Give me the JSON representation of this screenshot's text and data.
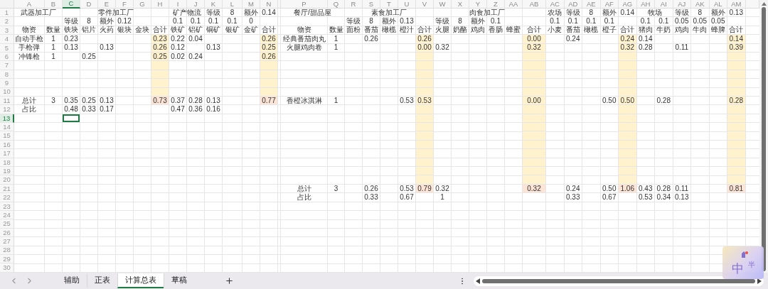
{
  "columns": [
    {
      "letter": "A",
      "selected": false
    },
    {
      "letter": "B",
      "selected": false
    },
    {
      "letter": "C",
      "selected": true
    },
    {
      "letter": "D",
      "selected": false
    },
    {
      "letter": "E",
      "selected": false
    },
    {
      "letter": "F",
      "selected": false
    },
    {
      "letter": "G",
      "selected": false
    },
    {
      "letter": "H",
      "selected": false
    },
    {
      "letter": "I",
      "selected": false
    },
    {
      "letter": "J",
      "selected": false
    },
    {
      "letter": "K",
      "selected": false
    },
    {
      "letter": "L",
      "selected": false
    },
    {
      "letter": "M",
      "selected": false
    },
    {
      "letter": "N",
      "selected": false
    },
    {
      "selected": false
    },
    {
      "letter": "P",
      "selected": false
    },
    {
      "letter": "Q",
      "selected": false
    },
    {
      "letter": "R",
      "selected": false
    },
    {
      "letter": "S",
      "selected": false
    },
    {
      "letter": "T",
      "selected": false
    },
    {
      "letter": "U",
      "selected": false
    },
    {
      "letter": "V",
      "selected": false
    },
    {
      "letter": "W",
      "selected": false
    },
    {
      "letter": "X",
      "selected": false
    },
    {
      "letter": "Y",
      "selected": false
    },
    {
      "letter": "Z",
      "selected": false
    },
    {
      "letter": "AA",
      "selected": false
    },
    {
      "letter": "AB",
      "selected": false
    },
    {
      "letter": "AC",
      "selected": false
    },
    {
      "letter": "AD",
      "selected": false
    },
    {
      "letter": "AE",
      "selected": false
    },
    {
      "letter": "AF",
      "selected": false
    },
    {
      "letter": "AG",
      "selected": false
    },
    {
      "letter": "AH",
      "selected": false
    },
    {
      "letter": "AI",
      "selected": false
    },
    {
      "letter": "AJ",
      "selected": false
    },
    {
      "letter": "AK",
      "selected": false
    },
    {
      "letter": "AL",
      "selected": false
    },
    {
      "letter": "AM",
      "selected": false
    }
  ],
  "rows": [
    {
      "number": "1",
      "selected": false,
      "cells": {
        "A:B": {
          "text": "武器加工厂"
        },
        "D:G": {
          "text": "零件加工厂"
        },
        "I:J": {
          "text": "矿产物流"
        },
        "K": {
          "text": "等级"
        },
        "L": {
          "text": "8"
        },
        "M": {
          "text": "额外"
        },
        "N": {
          "text": "0.14"
        },
        "P:Q": {
          "text": "餐厅/甜品屋"
        },
        "S:U": {
          "text": "素食加工厂"
        },
        "X:AA": {
          "text": "肉食加工厂"
        },
        "AC": {
          "text": "农场"
        },
        "AD": {
          "text": "等级"
        },
        "AE": {
          "text": "8"
        },
        "AF": {
          "text": "额外"
        },
        "AG": {
          "text": "0.14"
        },
        "AH:AI": {
          "text": "牧场"
        },
        "AJ": {
          "text": "等级"
        },
        "AK": {
          "text": "8"
        },
        "AL": {
          "text": "额外"
        },
        "AM": {
          "text": "0.13"
        }
      }
    },
    {
      "number": "2",
      "selected": false,
      "cells": {
        "C": {
          "text": "等级"
        },
        "D": {
          "text": "8"
        },
        "E": {
          "text": "额外"
        },
        "F": {
          "text": "0.12"
        },
        "I": {
          "text": "0.1"
        },
        "J": {
          "text": "0.1"
        },
        "K": {
          "text": "0.1"
        },
        "L": {
          "text": "0.1"
        },
        "M": {
          "text": "0"
        },
        "R": {
          "text": "等级"
        },
        "S": {
          "text": "8"
        },
        "T": {
          "text": "额外"
        },
        "U": {
          "text": "0.13"
        },
        "W": {
          "text": "等级"
        },
        "X": {
          "text": "8"
        },
        "Y": {
          "text": "额外"
        },
        "Z": {
          "text": "0.1"
        },
        "AC": {
          "text": "0.1"
        },
        "AD": {
          "text": "0.1"
        },
        "AE": {
          "text": "0.1"
        },
        "AF": {
          "text": "0.1"
        },
        "AH": {
          "text": "0.1"
        },
        "AI": {
          "text": "0.1"
        },
        "AJ": {
          "text": "0.05"
        },
        "AK": {
          "text": "0.05"
        },
        "AL": {
          "text": "0.05"
        }
      }
    },
    {
      "number": "3",
      "selected": false,
      "cells": {
        "A": {
          "text": "物资"
        },
        "B": {
          "text": "数量"
        },
        "C": {
          "text": "铁块"
        },
        "D": {
          "text": "铝片"
        },
        "E": {
          "text": "火药"
        },
        "F": {
          "text": "银块"
        },
        "G": {
          "text": "金块"
        },
        "H": {
          "text": "合计"
        },
        "I": {
          "text": "铁矿"
        },
        "J": {
          "text": "铝矿"
        },
        "K": {
          "text": "铜矿"
        },
        "L": {
          "text": "银矿"
        },
        "M": {
          "text": "金矿"
        },
        "N": {
          "text": "合计"
        },
        "P": {
          "text": "物资"
        },
        "Q": {
          "text": "数量"
        },
        "R": {
          "text": "面粉"
        },
        "S": {
          "text": "番茄"
        },
        "T": {
          "text": "橄榄"
        },
        "U": {
          "text": "橙汁"
        },
        "V": {
          "text": "合计"
        },
        "W": {
          "text": "火腿"
        },
        "X": {
          "text": "奶酪"
        },
        "Y": {
          "text": "鸡肉"
        },
        "Z": {
          "text": "香肠"
        },
        "AA": {
          "text": "蜂蜜"
        },
        "AB": {
          "text": "合计"
        },
        "AC": {
          "text": "小麦"
        },
        "AD": {
          "text": "番茄"
        },
        "AE": {
          "text": "橄榄"
        },
        "AF": {
          "text": "橙子"
        },
        "AG": {
          "text": "合计"
        },
        "AH": {
          "text": "猪肉"
        },
        "AI": {
          "text": "牛奶"
        },
        "AJ": {
          "text": "鸡肉"
        },
        "AK": {
          "text": "牛肉"
        },
        "AL": {
          "text": "蜂脾"
        },
        "AM": {
          "text": "合计"
        }
      }
    },
    {
      "number": "4",
      "selected": false,
      "cells": {
        "A": {
          "text": "自动手枪"
        },
        "B": {
          "text": "1"
        },
        "C": {
          "text": "0.23"
        },
        "H": {
          "text": "0.23",
          "color": "#fff2cc"
        },
        "I": {
          "text": "0.22"
        },
        "J": {
          "text": "0.04"
        },
        "N": {
          "text": "0.26",
          "color": "#fff2cc"
        },
        "P": {
          "text": "经典番茄肉丸"
        },
        "Q": {
          "text": "1"
        },
        "S": {
          "text": "0.26"
        },
        "V": {
          "text": "0.26",
          "color": "#fff2cc"
        },
        "AB": {
          "text": "0.00",
          "color": "#fff2cc"
        },
        "AD": {
          "text": "0.24"
        },
        "AG": {
          "text": "0.24",
          "color": "#fff2cc"
        },
        "AH": {
          "text": "0.14"
        },
        "AM": {
          "text": "0.14",
          "color": "#fff2cc"
        }
      }
    },
    {
      "number": "5",
      "selected": false,
      "cells": {
        "A": {
          "text": "手枪弹"
        },
        "B": {
          "text": "1"
        },
        "C": {
          "text": "0.13"
        },
        "E": {
          "text": "0.13"
        },
        "H": {
          "text": "0.26",
          "color": "#fff2cc"
        },
        "I": {
          "text": "0.12"
        },
        "K": {
          "text": "0.13"
        },
        "N": {
          "text": "0.25",
          "color": "#fff2cc"
        },
        "P": {
          "text": "火腿鸡肉卷"
        },
        "Q": {
          "text": "1"
        },
        "V": {
          "text": "0.00",
          "color": "#fff2cc"
        },
        "W": {
          "text": "0.32"
        },
        "AB": {
          "text": "0.32",
          "color": "#fff2cc"
        },
        "AG": {
          "text": "0.32",
          "color": "#fff2cc"
        },
        "AH": {
          "text": "0.28"
        },
        "AJ": {
          "text": "0.11"
        },
        "AM": {
          "text": "0.39",
          "color": "#fff2cc"
        }
      }
    },
    {
      "number": "6",
      "selected": false,
      "cells": {
        "A": {
          "text": "冲锋枪"
        },
        "B": {
          "text": "1"
        },
        "D": {
          "text": "0.25"
        },
        "H": {
          "text": "0.25",
          "color": "#fff2cc"
        },
        "I": {
          "text": "0.02"
        },
        "J": {
          "text": "0.24"
        },
        "N": {
          "text": "0.26",
          "color": "#fff2cc"
        },
        "V": {
          "color": "#fff2cc"
        },
        "AB": {
          "color": "#fff2cc"
        },
        "AG": {
          "color": "#fff2cc"
        },
        "AM": {
          "color": "#fff2cc"
        }
      }
    },
    {
      "number": "7",
      "selected": false,
      "cells": {
        "H": {
          "color": "#fff2cc"
        },
        "N": {
          "color": "#fff2cc"
        },
        "V": {
          "color": "#fff2cc"
        },
        "AB": {
          "color": "#fff2cc"
        },
        "AG": {
          "color": "#fff2cc"
        },
        "AM": {
          "color": "#fff2cc"
        }
      }
    },
    {
      "number": "8",
      "selected": false,
      "cells": {
        "H": {
          "color": "#fff2cc"
        },
        "N": {
          "color": "#fff2cc"
        },
        "V": {
          "color": "#fff2cc"
        },
        "AB": {
          "color": "#fff2cc"
        },
        "AG": {
          "color": "#fff2cc"
        },
        "AM": {
          "color": "#fff2cc"
        }
      }
    },
    {
      "number": "9",
      "selected": false,
      "cells": {
        "H": {
          "color": "#fff2cc"
        },
        "N": {
          "color": "#fff2cc"
        },
        "V": {
          "color": "#fff2cc"
        },
        "AB": {
          "color": "#fff2cc"
        },
        "AG": {
          "color": "#fff2cc"
        },
        "AM": {
          "color": "#fff2cc"
        }
      }
    },
    {
      "number": "10",
      "selected": false,
      "cells": {
        "H": {
          "color": "#fff2cc"
        },
        "N": {
          "color": "#fff2cc"
        },
        "V": {
          "color": "#fff2cc"
        },
        "AB": {
          "color": "#fff2cc"
        },
        "AG": {
          "color": "#fff2cc"
        },
        "AM": {
          "color": "#fff2cc"
        }
      }
    },
    {
      "number": "11",
      "selected": false,
      "cells": {
        "A": {
          "text": "总计"
        },
        "B": {
          "text": "3"
        },
        "C": {
          "text": "0.35"
        },
        "D": {
          "text": "0.25"
        },
        "E": {
          "text": "0.13"
        },
        "H": {
          "text": "0.73",
          "color": "#fce4d6"
        },
        "I": {
          "text": "0.37"
        },
        "J": {
          "text": "0.28"
        },
        "K": {
          "text": "0.13"
        },
        "N": {
          "text": "0.77",
          "color": "#fce4d6"
        },
        "P": {
          "text": "香橙冰淇淋"
        },
        "Q": {
          "text": "1"
        },
        "U": {
          "text": "0.53"
        },
        "V": {
          "text": "0.53",
          "color": "#fff2cc"
        },
        "AB": {
          "text": "0.00",
          "color": "#fff2cc"
        },
        "AF": {
          "text": "0.50"
        },
        "AG": {
          "text": "0.50",
          "color": "#fff2cc"
        },
        "AI": {
          "text": "0.28"
        },
        "AM": {
          "text": "0.28",
          "color": "#fff2cc"
        }
      }
    },
    {
      "number": "12",
      "selected": false,
      "cells": {
        "A": {
          "text": "占比"
        },
        "C": {
          "text": "0.48"
        },
        "D": {
          "text": "0.33"
        },
        "E": {
          "text": "0.17"
        },
        "I": {
          "text": "0.47"
        },
        "J": {
          "text": "0.36"
        },
        "K": {
          "text": "0.16"
        },
        "V": {
          "color": "#fff2cc"
        },
        "AB": {
          "color": "#fff2cc"
        },
        "AG": {
          "color": "#fff2cc"
        },
        "AM": {
          "color": "#fff2cc"
        }
      }
    },
    {
      "number": "13",
      "selected": true,
      "cells": {
        "V": {
          "color": "#fff2cc"
        },
        "AB": {
          "color": "#fff2cc"
        },
        "AG": {
          "color": "#fff2cc"
        },
        "AM": {
          "color": "#fff2cc"
        }
      }
    },
    {
      "number": "14",
      "selected": false,
      "cells": {
        "V": {
          "color": "#fff2cc"
        },
        "AB": {
          "color": "#fff2cc"
        },
        "AG": {
          "color": "#fff2cc"
        },
        "AM": {
          "color": "#fff2cc"
        }
      }
    },
    {
      "number": "15",
      "selected": false,
      "cells": {
        "V": {
          "color": "#fff2cc"
        },
        "AB": {
          "color": "#fff2cc"
        },
        "AG": {
          "color": "#fff2cc"
        },
        "AM": {
          "color": "#fff2cc"
        }
      }
    },
    {
      "number": "16",
      "selected": false,
      "cells": {
        "V": {
          "color": "#fff2cc"
        },
        "AB": {
          "color": "#fff2cc"
        },
        "AG": {
          "color": "#fff2cc"
        },
        "AM": {
          "color": "#fff2cc"
        }
      }
    },
    {
      "number": "17",
      "selected": false,
      "cells": {
        "V": {
          "color": "#fff2cc"
        },
        "AB": {
          "color": "#fff2cc"
        },
        "AG": {
          "color": "#fff2cc"
        },
        "AM": {
          "color": "#fff2cc"
        }
      }
    },
    {
      "number": "18",
      "selected": false,
      "cells": {
        "V": {
          "color": "#fff2cc"
        },
        "AB": {
          "color": "#fff2cc"
        },
        "AG": {
          "color": "#fff2cc"
        },
        "AM": {
          "color": "#fff2cc"
        }
      }
    },
    {
      "number": "19",
      "selected": false,
      "cells": {
        "V": {
          "color": "#fff2cc"
        },
        "AB": {
          "color": "#fff2cc"
        },
        "AG": {
          "color": "#fff2cc"
        },
        "AM": {
          "color": "#fff2cc"
        }
      }
    },
    {
      "number": "20",
      "selected": false,
      "cells": {
        "V": {
          "color": "#fff2cc"
        },
        "AB": {
          "color": "#fff2cc"
        },
        "AG": {
          "color": "#fff2cc"
        },
        "AM": {
          "color": "#fff2cc"
        }
      }
    },
    {
      "number": "21",
      "selected": false,
      "cells": {
        "P": {
          "text": "总计"
        },
        "Q": {
          "text": "3"
        },
        "S": {
          "text": "0.26"
        },
        "U": {
          "text": "0.53"
        },
        "V": {
          "text": "0.79",
          "color": "#fce4d6"
        },
        "W": {
          "text": "0.32"
        },
        "AB": {
          "text": "0.32",
          "color": "#fce4d6"
        },
        "AD": {
          "text": "0.24"
        },
        "AF": {
          "text": "0.50"
        },
        "AG": {
          "text": "1.06",
          "color": "#fce4d6"
        },
        "AH": {
          "text": "0.43"
        },
        "AI": {
          "text": "0.28"
        },
        "AJ": {
          "text": "0.11"
        },
        "AM": {
          "text": "0.81",
          "color": "#fce4d6"
        }
      }
    },
    {
      "number": "22",
      "selected": false,
      "cells": {
        "P": {
          "text": "占比"
        },
        "S": {
          "text": "0.33"
        },
        "U": {
          "text": "0.67"
        },
        "W": {
          "text": "1"
        },
        "AD": {
          "text": "0.33"
        },
        "AF": {
          "text": "0.67"
        },
        "AH": {
          "text": "0.53"
        },
        "AI": {
          "text": "0.34"
        },
        "AJ": {
          "text": "0.13"
        }
      }
    },
    {
      "number": "23",
      "selected": false
    },
    {
      "number": "24",
      "selected": false
    },
    {
      "number": "25",
      "selected": false
    },
    {
      "number": "26",
      "selected": false
    },
    {
      "number": "27",
      "selected": false
    },
    {
      "number": "28",
      "selected": false
    },
    {
      "number": "29",
      "selected": false
    },
    {
      "number": "30",
      "selected": false
    }
  ],
  "sheet_tabs": [
    {
      "label": "辅助",
      "selected": false
    },
    {
      "label": "正表",
      "selected": false
    },
    {
      "label": "计算总表",
      "selected": true
    },
    {
      "label": "草稿",
      "selected": false
    }
  ],
  "ime": {
    "mode": "中",
    "width": "半"
  }
}
